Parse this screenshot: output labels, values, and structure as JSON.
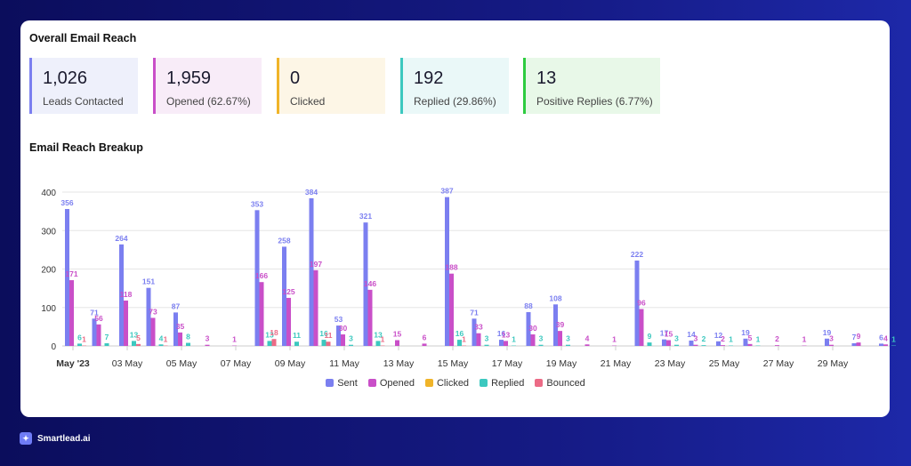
{
  "header": {
    "title": "Overall Email Reach"
  },
  "cards": [
    {
      "value": "1,026",
      "label": "Leads Contacted",
      "color": "#7b7ff0",
      "bg": "#eef0fb"
    },
    {
      "value": "1,959",
      "label": "Opened (62.67%)",
      "color": "#c94fc8",
      "bg": "#f8ecf8"
    },
    {
      "value": "0",
      "label": "Clicked",
      "color": "#f0b429",
      "bg": "#fdf6e6"
    },
    {
      "value": "192",
      "label": "Replied (29.86%)",
      "color": "#3cc8bf",
      "bg": "#eaf8f8"
    },
    {
      "value": "13",
      "label": "Positive Replies (6.77%)",
      "color": "#2ecc40",
      "bg": "#e8f8e8"
    }
  ],
  "section": {
    "title": "Email Reach Breakup"
  },
  "brand": {
    "name": "Smartlead.ai"
  },
  "chart_data": {
    "type": "bar",
    "ylim": [
      0,
      400
    ],
    "yticks": [
      0,
      100,
      200,
      300,
      400
    ],
    "grid": true,
    "legend_placement": "bottom",
    "categories": [
      "1",
      "2",
      "3",
      "4",
      "5",
      "6",
      "7",
      "8",
      "9",
      "10",
      "11",
      "12",
      "13",
      "14",
      "15",
      "16",
      "17",
      "18",
      "19",
      "20",
      "21",
      "22",
      "23",
      "24",
      "25",
      "26",
      "27",
      "28",
      "29",
      "30",
      "31"
    ],
    "xtick_labels": [
      "May '23",
      "03 May",
      "05 May",
      "07 May",
      "09 May",
      "11 May",
      "13 May",
      "15 May",
      "17 May",
      "19 May",
      "21 May",
      "23 May",
      "25 May",
      "27 May",
      "29 May"
    ],
    "series": [
      {
        "name": "Sent",
        "color": "#7b7ff0",
        "values": [
          356,
          71,
          264,
          151,
          87,
          0,
          0,
          353,
          258,
          384,
          53,
          321,
          0,
          0,
          387,
          71,
          16,
          88,
          108,
          0,
          0,
          222,
          17,
          14,
          12,
          19,
          0,
          0,
          19,
          7,
          6
        ]
      },
      {
        "name": "Opened",
        "color": "#c94fc8",
        "values": [
          171,
          56,
          118,
          73,
          35,
          3,
          1,
          166,
          125,
          197,
          30,
          146,
          15,
          6,
          188,
          33,
          13,
          30,
          39,
          4,
          1,
          96,
          15,
          3,
          2,
          5,
          2,
          1,
          3,
          9,
          4
        ]
      },
      {
        "name": "Clicked",
        "color": "#f0b429",
        "values": [
          0,
          0,
          0,
          0,
          0,
          0,
          0,
          0,
          0,
          0,
          0,
          0,
          0,
          0,
          0,
          0,
          0,
          0,
          0,
          0,
          0,
          0,
          0,
          0,
          0,
          0,
          0,
          0,
          0,
          0,
          0
        ]
      },
      {
        "name": "Replied",
        "color": "#3cc8bf",
        "values": [
          6,
          7,
          13,
          4,
          8,
          0,
          0,
          13,
          11,
          16,
          3,
          13,
          0,
          0,
          16,
          3,
          1,
          3,
          3,
          0,
          0,
          9,
          3,
          2,
          1,
          1,
          0,
          0,
          0,
          0,
          1
        ]
      },
      {
        "name": "Bounced",
        "color": "#ec6b86",
        "values": [
          1,
          0,
          5,
          1,
          0,
          0,
          0,
          18,
          0,
          11,
          0,
          1,
          0,
          0,
          1,
          0,
          0,
          0,
          0,
          0,
          0,
          0,
          0,
          0,
          0,
          0,
          0,
          0,
          0,
          0,
          0
        ]
      }
    ]
  }
}
